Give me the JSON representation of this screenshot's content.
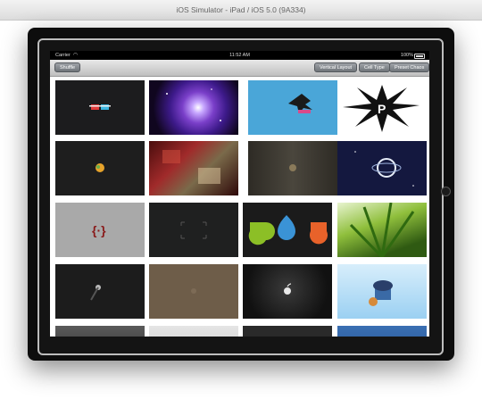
{
  "simulator": {
    "title": "iOS Simulator - iPad / iOS 5.0 (9A334)"
  },
  "status_bar": {
    "carrier": "Carrier",
    "time": "11:52 AM",
    "battery": "100%"
  },
  "toolbar": {
    "shuffle_label": "Shuffle",
    "vertical_layout_label": "Vertical Layout",
    "cell_type_label": "Cell Type",
    "preset_chaos_label": "Preset Chaos"
  },
  "grid": {
    "cells": [
      {
        "icon": "3d-glasses-icon"
      },
      {
        "icon": "galaxy-icon"
      },
      {
        "icon": "skydiver-icon"
      },
      {
        "icon": "splash-logo-icon"
      },
      {
        "icon": "apple-logo-icon"
      },
      {
        "icon": "abstract-texture-icon"
      },
      {
        "icon": "apple-logo-icon"
      },
      {
        "icon": "planet-icon"
      },
      {
        "icon": "braces-icon"
      },
      {
        "icon": "viewfinder-icon"
      },
      {
        "icon": "colored-drops-icon"
      },
      {
        "icon": "plant-icon"
      },
      {
        "icon": "comet-icon"
      },
      {
        "icon": "texture-icon"
      },
      {
        "icon": "apple-logo-icon"
      },
      {
        "icon": "cupcake-icon"
      },
      {
        "icon": "photo-icon"
      },
      {
        "icon": "photo-icon"
      },
      {
        "icon": "photo-icon"
      },
      {
        "icon": "photo-icon"
      }
    ]
  }
}
